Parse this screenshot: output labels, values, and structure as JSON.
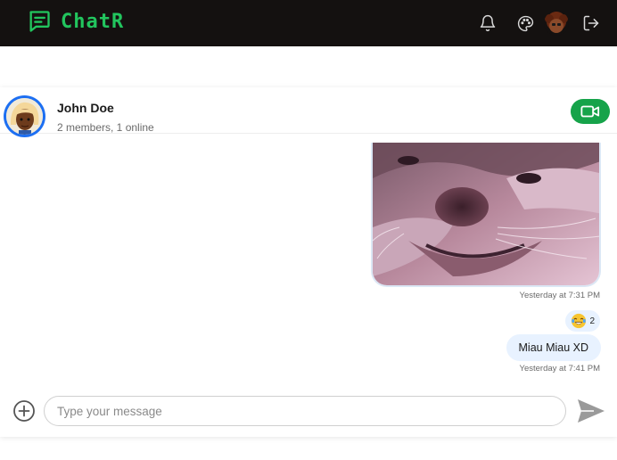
{
  "app": {
    "brand": "ChatR",
    "brand_color": "#22c55e",
    "topbar_bg": "#141110"
  },
  "topbar": {
    "icons": [
      "bell-icon",
      "palette-icon",
      "user-avatar",
      "logout-icon"
    ]
  },
  "chat": {
    "title": "John Doe",
    "subtitle": "2 members, 1 online",
    "video_button_color": "#16a34a"
  },
  "messages": [
    {
      "type": "image",
      "alt": "cat",
      "timestamp": "Yesterday at 7:31 PM"
    },
    {
      "type": "text",
      "text": "Miau Miau XD",
      "timestamp": "Yesterday at 7:41 PM",
      "reaction": {
        "emoji": "😂",
        "count": "2"
      }
    }
  ],
  "composer": {
    "placeholder": "Type your message"
  }
}
